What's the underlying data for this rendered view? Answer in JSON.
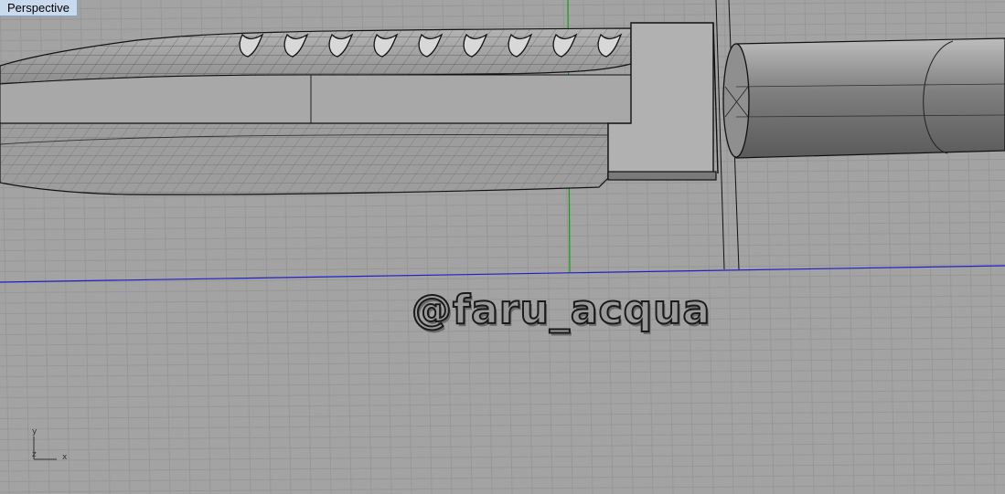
{
  "viewport": {
    "title": "Perspective"
  },
  "watermark": {
    "text": "@faru_acqua"
  },
  "axis_widget": {
    "x_label": "x",
    "y_label": "y",
    "z_label": "z"
  },
  "colors": {
    "background": "#a3a3a3",
    "grid": "#979797",
    "x_axis": "#2020c8",
    "y_axis": "#10a010",
    "edges": "#111111"
  }
}
